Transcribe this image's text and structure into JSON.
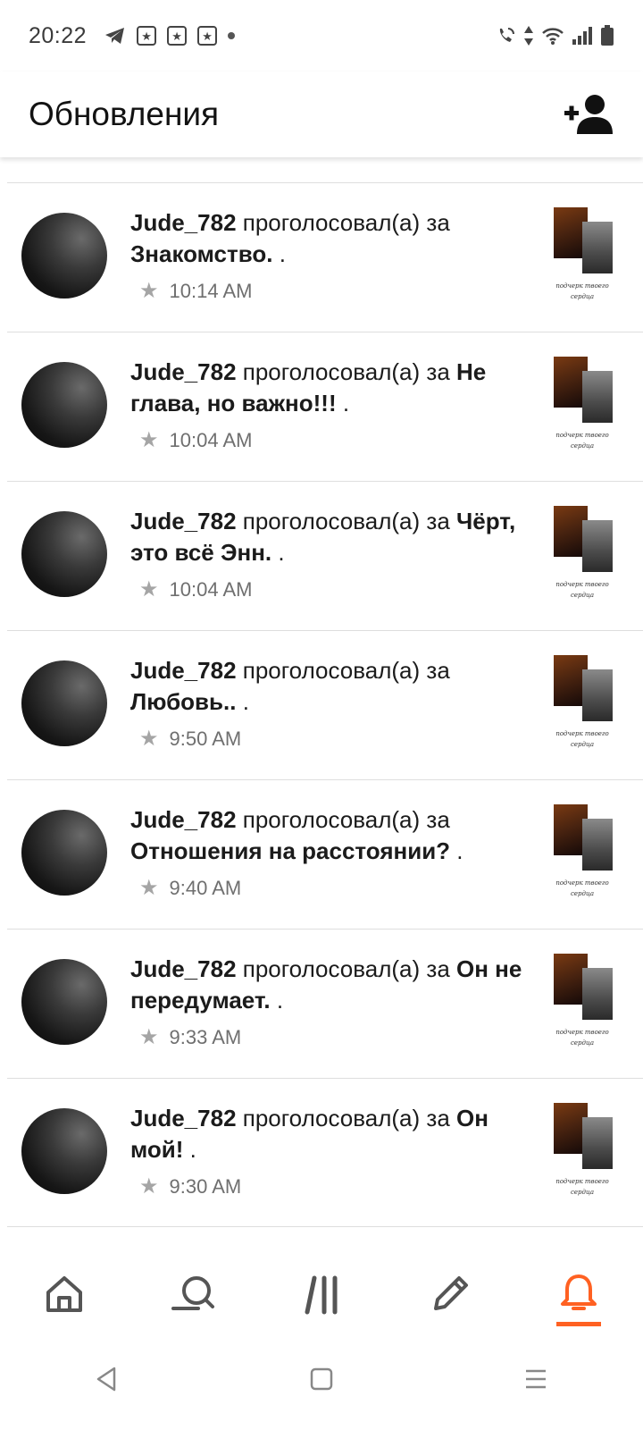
{
  "status_bar": {
    "time": "20:22",
    "left_icons": [
      "telegram-icon",
      "app-star-icon",
      "app-star-icon",
      "app-star-icon",
      "dot-icon"
    ],
    "right_icons": [
      "wifi-call-icon",
      "data-arrows-icon",
      "wifi-icon",
      "signal-icon",
      "battery-icon"
    ]
  },
  "header": {
    "title": "Обновления",
    "action_icon": "add-friend-icon"
  },
  "feed": {
    "items": [
      {
        "user": "Jude_782",
        "action": "проголосовал(а) за",
        "part": "Знакомство.",
        "suffix": ".",
        "time": "10:14 AM",
        "cover_caption": "подчерк твоего сердца"
      },
      {
        "user": "Jude_782",
        "action": "проголосовал(а) за",
        "part": "Не глава, но важно!!!",
        "suffix": ".",
        "time": "10:04 AM",
        "cover_caption": "подчерк твоего сердца"
      },
      {
        "user": "Jude_782",
        "action": "проголосовал(а) за",
        "part": "Чёрт, это всё Энн.",
        "suffix": ".",
        "time": "10:04 AM",
        "cover_caption": "подчерк твоего сердца"
      },
      {
        "user": "Jude_782",
        "action": "проголосовал(а) за",
        "part": "Любовь..",
        "suffix": ".",
        "time": "9:50 AM",
        "cover_caption": "подчерк твоего сердца"
      },
      {
        "user": "Jude_782",
        "action": "проголосовал(а) за",
        "part": "Отношения на расстоянии?",
        "suffix": ".",
        "time": "9:40 AM",
        "cover_caption": "подчерк твоего сердца"
      },
      {
        "user": "Jude_782",
        "action": "проголосовал(а) за",
        "part": "Он не передумает.",
        "suffix": ".",
        "time": "9:33 AM",
        "cover_caption": "подчерк твоего сердца"
      },
      {
        "user": "Jude_782",
        "action": "проголосовал(а) за",
        "part": "Он мой!",
        "suffix": ".",
        "time": "9:30 AM",
        "cover_caption": "подчерк твоего сердца"
      }
    ]
  },
  "bottom_nav": {
    "tabs": [
      "home-icon",
      "search-icon",
      "library-icon",
      "write-icon",
      "notifications-icon"
    ],
    "active": "notifications-icon",
    "accent_color": "#ff6122"
  },
  "system_nav": [
    "back-icon",
    "home-square-icon",
    "menu-icon"
  ]
}
